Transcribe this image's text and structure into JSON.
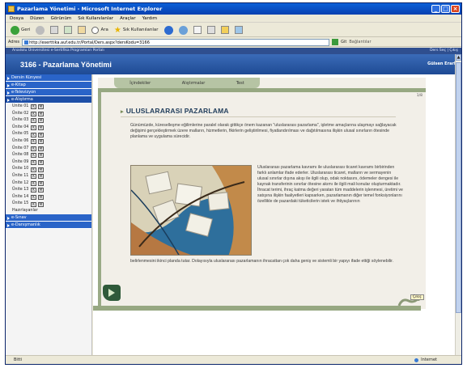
{
  "window": {
    "title": "Pazarlama Yönetimi - Microsoft Internet Explorer",
    "controls": [
      "_",
      "□",
      "×"
    ]
  },
  "menubar": [
    "Dosya",
    "Düzen",
    "Görünüm",
    "Sık Kullanılanlar",
    "Araçlar",
    "Yardım"
  ],
  "toolbar": {
    "back_label": "Geri",
    "search_label": "Ara",
    "favorites_label": "Sık Kullanılanlar"
  },
  "address": {
    "label": "Adres",
    "url": "http://eserttika.auf.edu.tr/Portal/Ders.aspx?dersKodu=3166",
    "go_label": "Git",
    "links_label": "Bağlantılar"
  },
  "info_strip": {
    "left": "Anadolu Üniversitesi e-Sertifika Programları Portalı",
    "right": "Ders Seç | Çıkış"
  },
  "header": {
    "course_title": "3166 - Pazarlama Yönetimi",
    "user": "Gülsen Erarla"
  },
  "sidebar": {
    "sections": [
      "Dersin Künyesi",
      "e-Kitap",
      "e-Televizyon",
      "e-Alıştırma"
    ],
    "units": [
      "Ünite 01",
      "Ünite 02",
      "Ünite 03",
      "Ünite 04",
      "Ünite 05",
      "Ünite 06",
      "Ünite 07",
      "Ünite 08",
      "Ünite 09",
      "Ünite 10",
      "Ünite 11",
      "Ünite 12",
      "Ünite 13",
      "Ünite 14",
      "Ünite 15"
    ],
    "unit_buttons": [
      "K",
      "M"
    ],
    "misc_item": "Hazırlayanlar",
    "bottom_sections": [
      "e-Sınav",
      "e-Danışmanlık"
    ]
  },
  "content": {
    "tabs": [
      "İçindekiler",
      "Alıştırmalar",
      "Test"
    ],
    "page_number": "1/8",
    "heading": "ULUSLARARASI PAZARLAMA",
    "paragraph1": "Günümüzde, küreselleşme eğilimlerine paralel olarak gittikçe önem kazanan \"uluslararası pazarlama\", işletme amaçlarına ulaşmayı sağlayacak değişimi gerçekleştirmek üzere malların, hizmetlerin, fikirlerin geliştirilmesi, fiyatlandırılması ve dağıtılmasına ilişkin ulusal sınırların ötesinde planlama ve uygulama sürecidir.",
    "paragraph2": "Uluslararası pazarlama kavramı ile uluslararası ticaret kavramı birbirinden farklı anlamlar ifade ederler. Uluslararası ticaret, malların ve sermayenin ulusal sınırlar dışına akışı ile ilgili olup, odak noktasını, ödemeler dengesi ile kaynak transferinin sınırlar ötesine akımı ile ilgili mali konular oluşturmaktadır. İhracat terimi, ihraç katma değeri yaratan tüm maddelerin işlenmesi, üretimi ve satışına ilişkin faaliyetleri kapsarken, pazarlamanın diğer temel fonksiyonlarını özellikle de pazardaki tüketicilerin istek ve ihtiyaçlarının",
    "paragraph3": "belirlenmesini ikinci planda tutar. Dolayısıyla uluslararası pazarlamanın ihracattan çok daha geniş ve sistemli bir yapıyı ifade ettiği söylenebilir.",
    "exit_label": "Çıkış"
  },
  "statusbar": {
    "left": "Bitti",
    "zone": "Internet"
  },
  "colors": {
    "header_blue": "#1e4a94",
    "nav_blue": "#2a64c8",
    "olive": "#97a882",
    "heading": "#24405e"
  }
}
